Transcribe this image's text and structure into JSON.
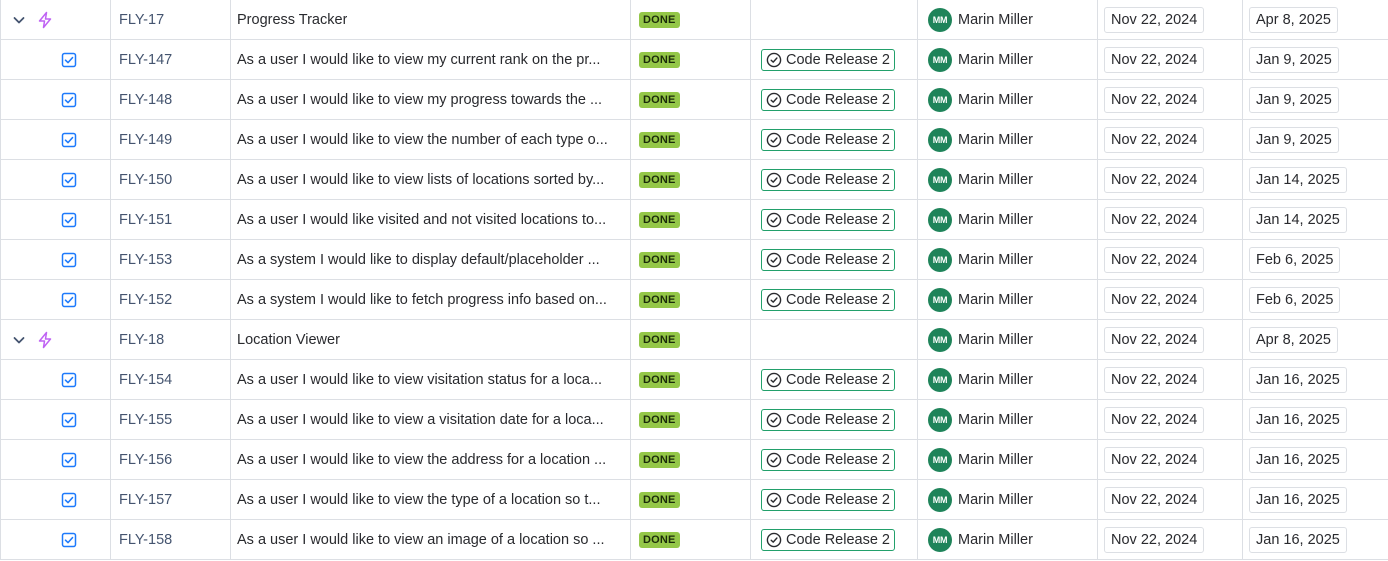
{
  "colors": {
    "epic": "#bf63f3",
    "story": "#1d7afc",
    "done": "#94c748",
    "version_border": "#22a06b",
    "avatar": "#1f845a"
  },
  "rows": [
    {
      "type": "epic",
      "key": "FLY-17",
      "summary": "Progress Tracker",
      "status": "DONE",
      "fix": "",
      "assignee": "Marin Miller",
      "initials": "MM",
      "start": "Nov 22, 2024",
      "due": "Apr 8, 2025"
    },
    {
      "type": "story",
      "key": "FLY-147",
      "summary": "As a user I would like to view my current rank on the pr...",
      "status": "DONE",
      "fix": "Code Release 2",
      "assignee": "Marin Miller",
      "initials": "MM",
      "start": "Nov 22, 2024",
      "due": "Jan 9, 2025"
    },
    {
      "type": "story",
      "key": "FLY-148",
      "summary": "As a user I would like to view my progress towards the ...",
      "status": "DONE",
      "fix": "Code Release 2",
      "assignee": "Marin Miller",
      "initials": "MM",
      "start": "Nov 22, 2024",
      "due": "Jan 9, 2025"
    },
    {
      "type": "story",
      "key": "FLY-149",
      "summary": "As a user I would like to view the number of each type o...",
      "status": "DONE",
      "fix": "Code Release 2",
      "assignee": "Marin Miller",
      "initials": "MM",
      "start": "Nov 22, 2024",
      "due": "Jan 9, 2025"
    },
    {
      "type": "story",
      "key": "FLY-150",
      "summary": "As a user I would like to view lists of locations sorted by...",
      "status": "DONE",
      "fix": "Code Release 2",
      "assignee": "Marin Miller",
      "initials": "MM",
      "start": "Nov 22, 2024",
      "due": "Jan 14, 2025"
    },
    {
      "type": "story",
      "key": "FLY-151",
      "summary": "As a user I would like visited and not visited locations to...",
      "status": "DONE",
      "fix": "Code Release 2",
      "assignee": "Marin Miller",
      "initials": "MM",
      "start": "Nov 22, 2024",
      "due": "Jan 14, 2025"
    },
    {
      "type": "story",
      "key": "FLY-153",
      "summary": "As a system I would like to display default/placeholder ...",
      "status": "DONE",
      "fix": "Code Release 2",
      "assignee": "Marin Miller",
      "initials": "MM",
      "start": "Nov 22, 2024",
      "due": "Feb 6, 2025"
    },
    {
      "type": "story",
      "key": "FLY-152",
      "summary": "As a system I would like to fetch progress info based on...",
      "status": "DONE",
      "fix": "Code Release 2",
      "assignee": "Marin Miller",
      "initials": "MM",
      "start": "Nov 22, 2024",
      "due": "Feb 6, 2025"
    },
    {
      "type": "epic",
      "key": "FLY-18",
      "summary": "Location Viewer",
      "status": "DONE",
      "fix": "",
      "assignee": "Marin Miller",
      "initials": "MM",
      "start": "Nov 22, 2024",
      "due": "Apr 8, 2025"
    },
    {
      "type": "story",
      "key": "FLY-154",
      "summary": "As a user I would like to view visitation status for a loca...",
      "status": "DONE",
      "fix": "Code Release 2",
      "assignee": "Marin Miller",
      "initials": "MM",
      "start": "Nov 22, 2024",
      "due": "Jan 16, 2025"
    },
    {
      "type": "story",
      "key": "FLY-155",
      "summary": "As a user I would like to view a visitation date for a loca...",
      "status": "DONE",
      "fix": "Code Release 2",
      "assignee": "Marin Miller",
      "initials": "MM",
      "start": "Nov 22, 2024",
      "due": "Jan 16, 2025"
    },
    {
      "type": "story",
      "key": "FLY-156",
      "summary": "As a user I would like to view the address for a location ...",
      "status": "DONE",
      "fix": "Code Release 2",
      "assignee": "Marin Miller",
      "initials": "MM",
      "start": "Nov 22, 2024",
      "due": "Jan 16, 2025"
    },
    {
      "type": "story",
      "key": "FLY-157",
      "summary": "As a user I would like to view the type of a location so t...",
      "status": "DONE",
      "fix": "Code Release 2",
      "assignee": "Marin Miller",
      "initials": "MM",
      "start": "Nov 22, 2024",
      "due": "Jan 16, 2025"
    },
    {
      "type": "story",
      "key": "FLY-158",
      "summary": "As a user I would like to view an image of a location so ...",
      "status": "DONE",
      "fix": "Code Release 2",
      "assignee": "Marin Miller",
      "initials": "MM",
      "start": "Nov 22, 2024",
      "due": "Jan 16, 2025"
    }
  ]
}
